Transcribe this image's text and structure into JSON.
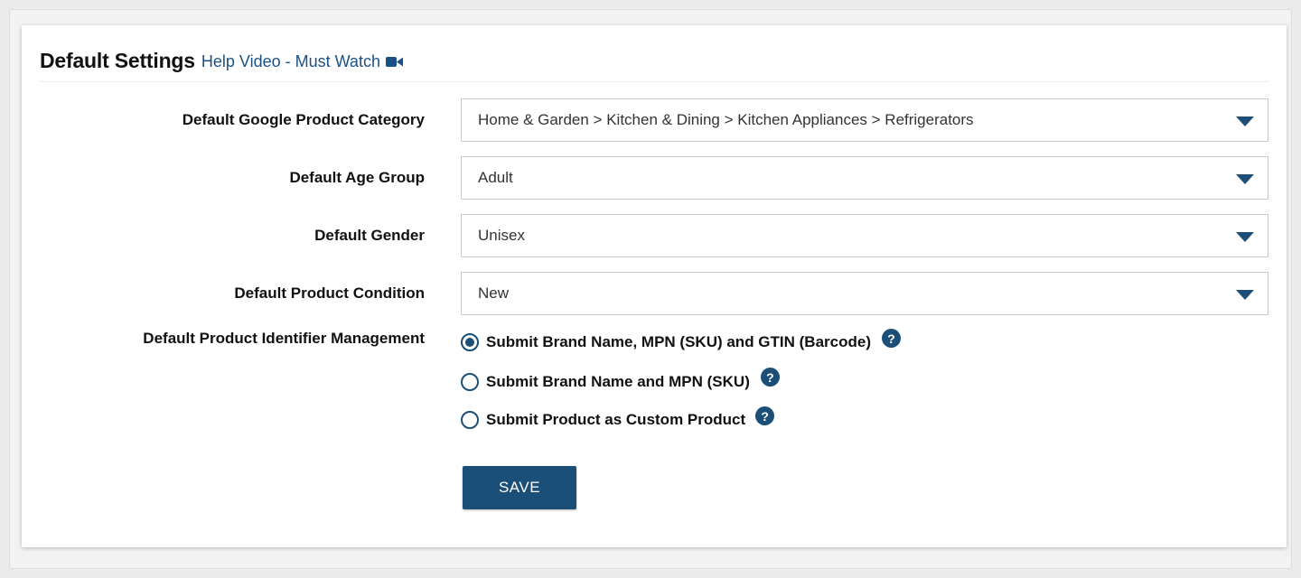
{
  "header": {
    "title": "Default Settings",
    "help_link": "Help Video - Must Watch",
    "help_icon": "video-camera-icon"
  },
  "form": {
    "fields": [
      {
        "label": "Default Google Product Category",
        "value": "Home & Garden > Kitchen & Dining > Kitchen Appliances > Refrigerators"
      },
      {
        "label": "Default Age Group",
        "value": "Adult"
      },
      {
        "label": "Default Gender",
        "value": "Unisex"
      },
      {
        "label": "Default Product Condition",
        "value": "New"
      }
    ],
    "identifier": {
      "label": "Default Product Identifier Management",
      "options": [
        {
          "label": "Submit Brand Name, MPN (SKU) and GTIN (Barcode)",
          "selected": true,
          "help": "?"
        },
        {
          "label": "Submit Brand Name and MPN (SKU)",
          "selected": false,
          "help": "?"
        },
        {
          "label": "Submit Product as Custom Product",
          "selected": false,
          "help": "?"
        }
      ]
    },
    "save_label": "SAVE"
  },
  "colors": {
    "accent": "#1c4f77",
    "link": "#1a5184"
  }
}
